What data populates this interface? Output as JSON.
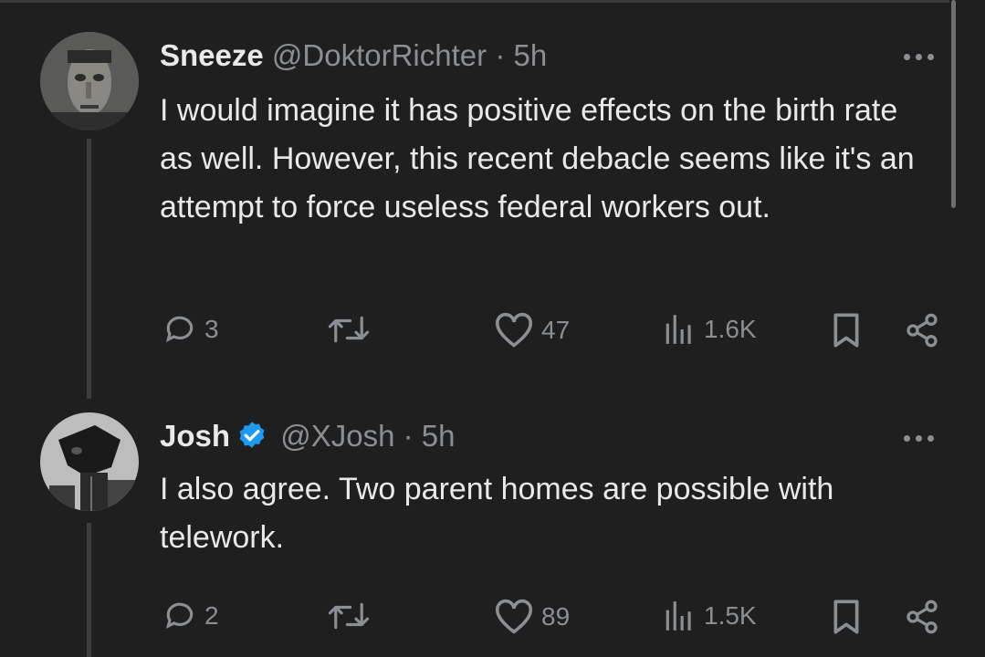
{
  "tweets": [
    {
      "name": "Sneeze",
      "handle": "@DoktorRichter",
      "separator": "·",
      "time": "5h",
      "verified": false,
      "text": "I would imagine it has positive effects on the birth rate as well. However, this recent debacle seems like it's an attempt to force useless federal workers out.",
      "replies": "3",
      "likes": "47",
      "views": "1.6K",
      "avatar_icon": "portrait-avatar"
    },
    {
      "name": "Josh",
      "handle": "@XJosh",
      "separator": "·",
      "time": "5h",
      "verified": true,
      "text": "I also agree. Two parent homes are possible with telework.",
      "replies": "2",
      "likes": "89",
      "views": "1.5K",
      "avatar_icon": "horse-head-avatar"
    }
  ],
  "colors": {
    "background": "#1f1f1f",
    "primary_text": "#e7e9ea",
    "secondary_text": "#8b8f93",
    "verified_blue": "#1d9bf0"
  },
  "icons": [
    "reply-icon",
    "retweet-icon",
    "like-icon",
    "views-icon",
    "bookmark-icon",
    "share-icon",
    "more-icon",
    "verified-badge-icon"
  ]
}
